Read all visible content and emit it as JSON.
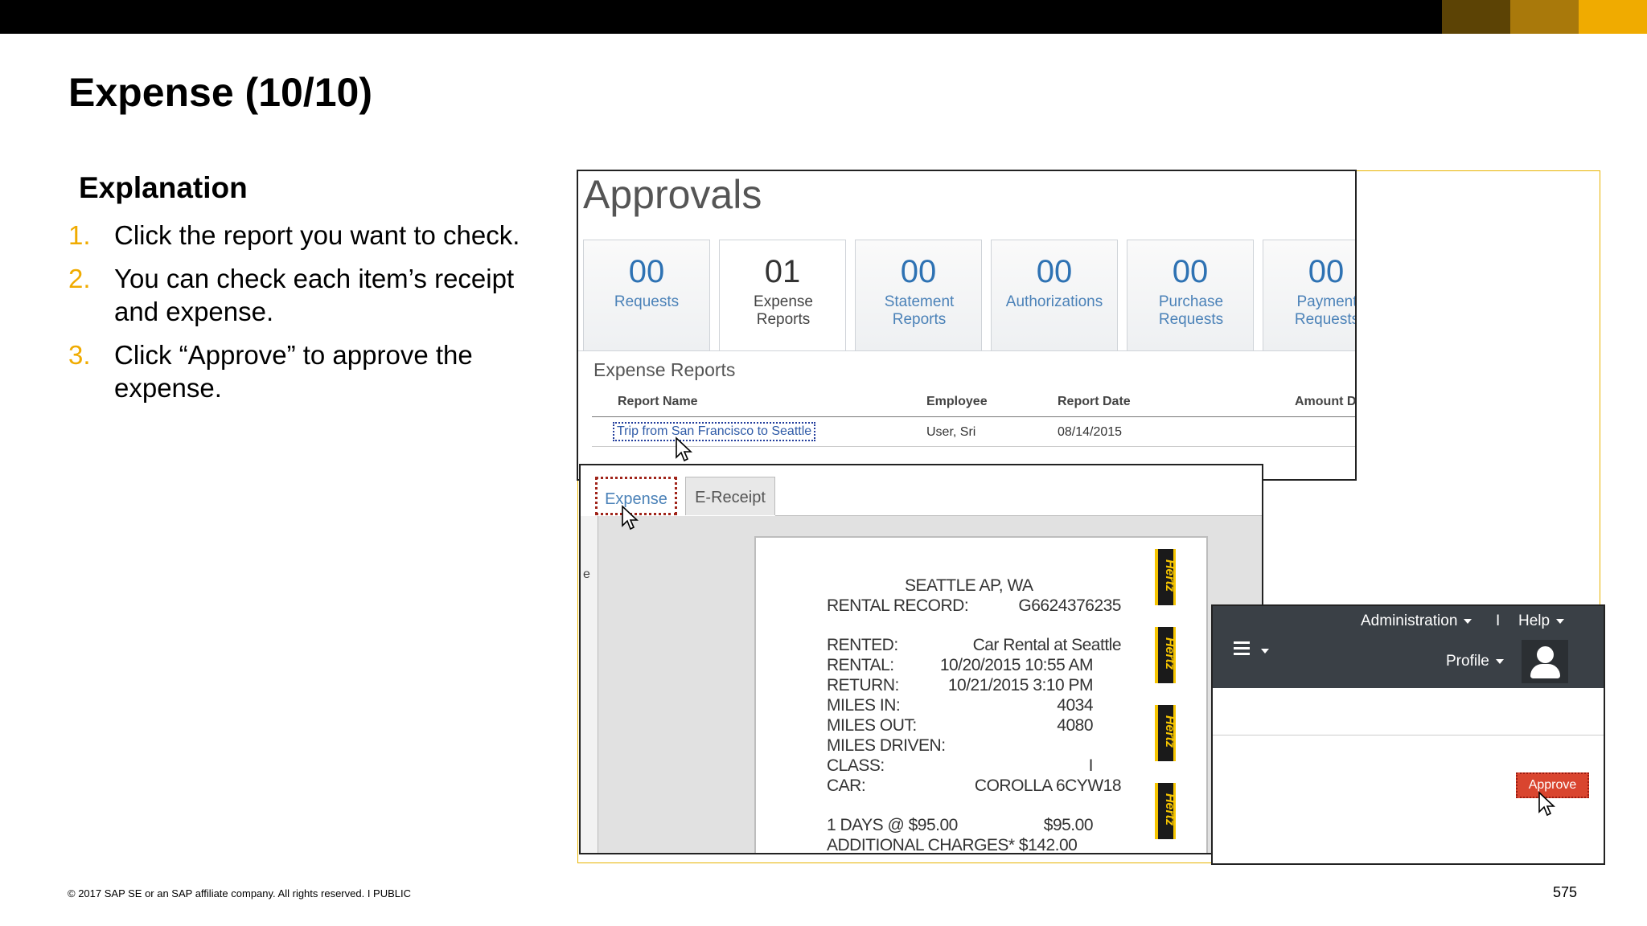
{
  "slide": {
    "title": "Expense (10/10)",
    "subheading": "Explanation",
    "steps": [
      {
        "num": "1.",
        "text": "Click the report you want to check."
      },
      {
        "num": "2.",
        "text": "You can check each item’s receipt and expense."
      },
      {
        "num": "3.",
        "text": "Click “Approve” to approve the expense."
      }
    ],
    "footer": "© 2017 SAP SE or an SAP affiliate company. All rights reserved.   I   PUBLIC",
    "page_number": "575",
    "accent_colors": [
      "#5c4305",
      "#a9790b",
      "#f0ab00"
    ]
  },
  "approvals": {
    "title": "Approvals",
    "tiles": [
      {
        "count": "00",
        "label": "Requests"
      },
      {
        "count": "01",
        "label": "Expense Reports"
      },
      {
        "count": "00",
        "label": "Statement Reports"
      },
      {
        "count": "00",
        "label": "Authorizations"
      },
      {
        "count": "00",
        "label": "Purchase Requests"
      },
      {
        "count": "00",
        "label": "Payment Requests"
      }
    ],
    "section_title": "Expense Reports",
    "columns": [
      "Report Name",
      "Employee",
      "Report Date",
      "Amount D"
    ],
    "row": {
      "report_name": "Trip from San Francisco to Seattle",
      "employee": "User, Sri",
      "report_date": "08/14/2015"
    }
  },
  "expense_view": {
    "tabs": [
      "Expense",
      "E-Receipt"
    ],
    "side_letter": "e",
    "receipt": {
      "location": "SEATTLE AP, WA",
      "lines": [
        {
          "label": "RENTAL RECORD:",
          "value": "G6624376235"
        },
        {
          "label": "RENTED:",
          "value": "Car Rental at Seattle"
        },
        {
          "label": "RENTAL:",
          "value": "10/20/2015 10:55 AM"
        },
        {
          "label": "RETURN:",
          "value": "10/21/2015 3:10 PM"
        },
        {
          "label": "MILES IN:",
          "value": "4034"
        },
        {
          "label": "MILES OUT:",
          "value": "4080"
        },
        {
          "label": "MILES DRIVEN:",
          "value": ""
        },
        {
          "label": "CLASS:",
          "value": "I"
        },
        {
          "label": "CAR:",
          "value": "COROLLA 6CYW18"
        },
        {
          "label": "1 DAYS @ $95.00",
          "value": "$95.00"
        },
        {
          "label": "ADDITIONAL CHARGES* $142.00",
          "value": ""
        }
      ],
      "logo_text": "Hertz"
    }
  },
  "header": {
    "administration": "Administration",
    "separator": "I",
    "help": "Help",
    "profile": "Profile",
    "approve_button": "Approve"
  }
}
